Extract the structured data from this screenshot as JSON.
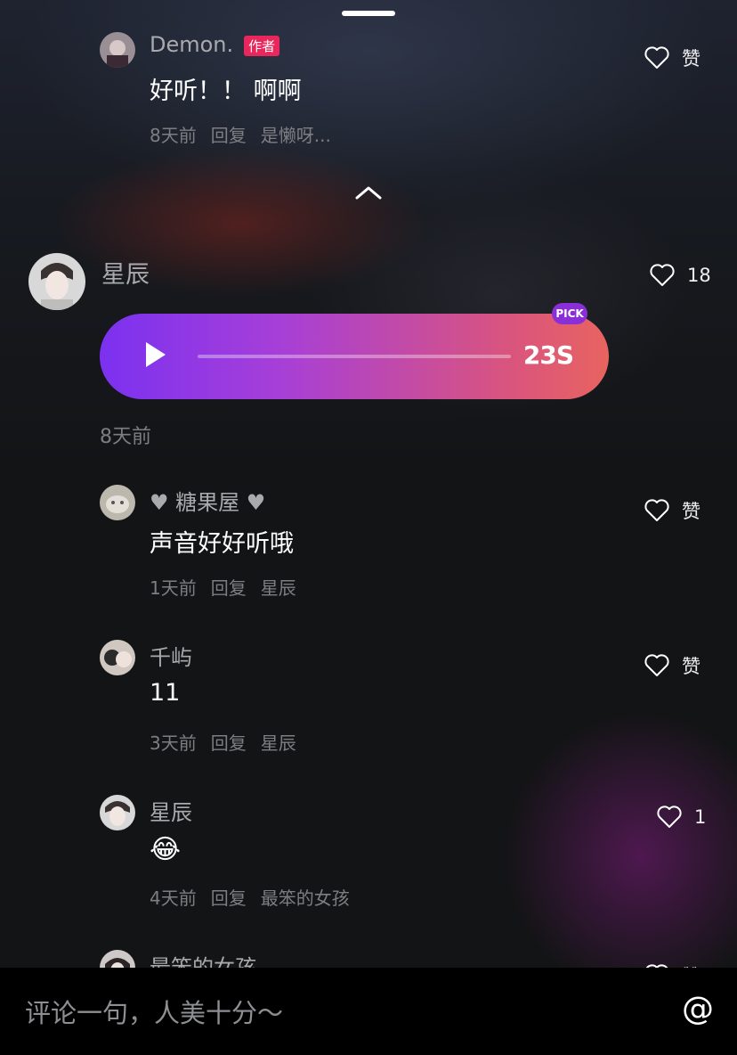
{
  "comments_top": {
    "name": "Demon.",
    "badge": "作者",
    "content": "好听！！ 啊啊",
    "time": "8天前",
    "reply_label": "回复",
    "reply_to": "是懒呀...",
    "like_label": "赞"
  },
  "main_comment": {
    "name": "星辰",
    "likes": "18",
    "voice_duration": "23S",
    "pick_label": "PICK",
    "time": "8天前"
  },
  "replies": [
    {
      "name": "♥ 糖果屋 ♥",
      "content": "声音好好听哦",
      "time": "1天前",
      "reply_label": "回复",
      "reply_to": "星辰",
      "like_label": "赞"
    },
    {
      "name": "千屿",
      "content": "11",
      "time": "3天前",
      "reply_label": "回复",
      "reply_to": "星辰",
      "like_label": "赞"
    },
    {
      "name": "星辰",
      "content": "😂",
      "time": "4天前",
      "reply_label": "回复",
      "reply_to": "最笨的女孩",
      "like_label": "1"
    },
    {
      "name": "最笨的女孩",
      "like_label": "赞"
    }
  ],
  "input": {
    "placeholder": "评论一句，人美十分～",
    "at_symbol": "@"
  },
  "colors": {
    "voice_start": "#7b31f0",
    "voice_end": "#e8645f",
    "author_badge": "#e9275c",
    "pick_badge": "#8a2fd8"
  }
}
